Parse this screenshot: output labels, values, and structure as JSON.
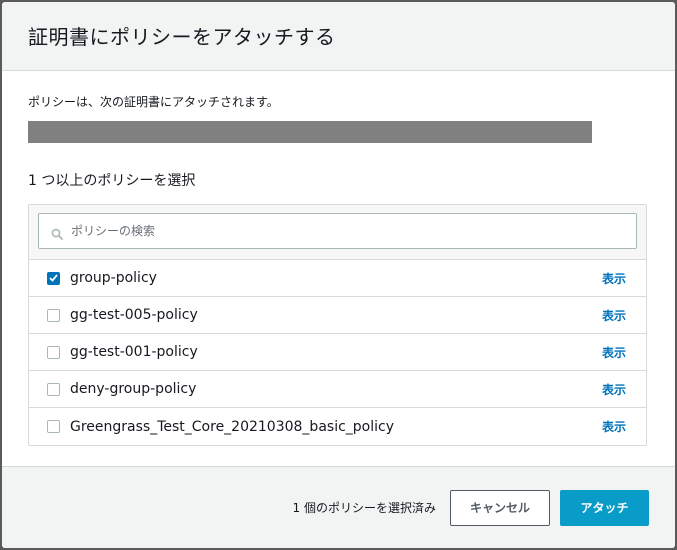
{
  "dialog": {
    "title": "証明書にポリシーをアタッチする",
    "description": "ポリシーは、次の証明書にアタッチされます。",
    "section_label": "1 つ以上のポリシーを選択",
    "search": {
      "placeholder": "ポリシーの検索",
      "value": ""
    },
    "policies": [
      {
        "name": "group-policy",
        "checked": true,
        "show_label": "表示"
      },
      {
        "name": "gg-test-005-policy",
        "checked": false,
        "show_label": "表示"
      },
      {
        "name": "gg-test-001-policy",
        "checked": false,
        "show_label": "表示"
      },
      {
        "name": "deny-group-policy",
        "checked": false,
        "show_label": "表示"
      },
      {
        "name": "Greengrass_Test_Core_20210308_basic_policy",
        "checked": false,
        "show_label": "表示"
      }
    ],
    "footer": {
      "selected_count": "1 個のポリシーを選択済み",
      "cancel_label": "キャンセル",
      "attach_label": "アタッチ"
    }
  },
  "colors": {
    "accent": "#0073bb",
    "primary_button": "#0a9cc8",
    "redacted_bar": "#808080"
  }
}
